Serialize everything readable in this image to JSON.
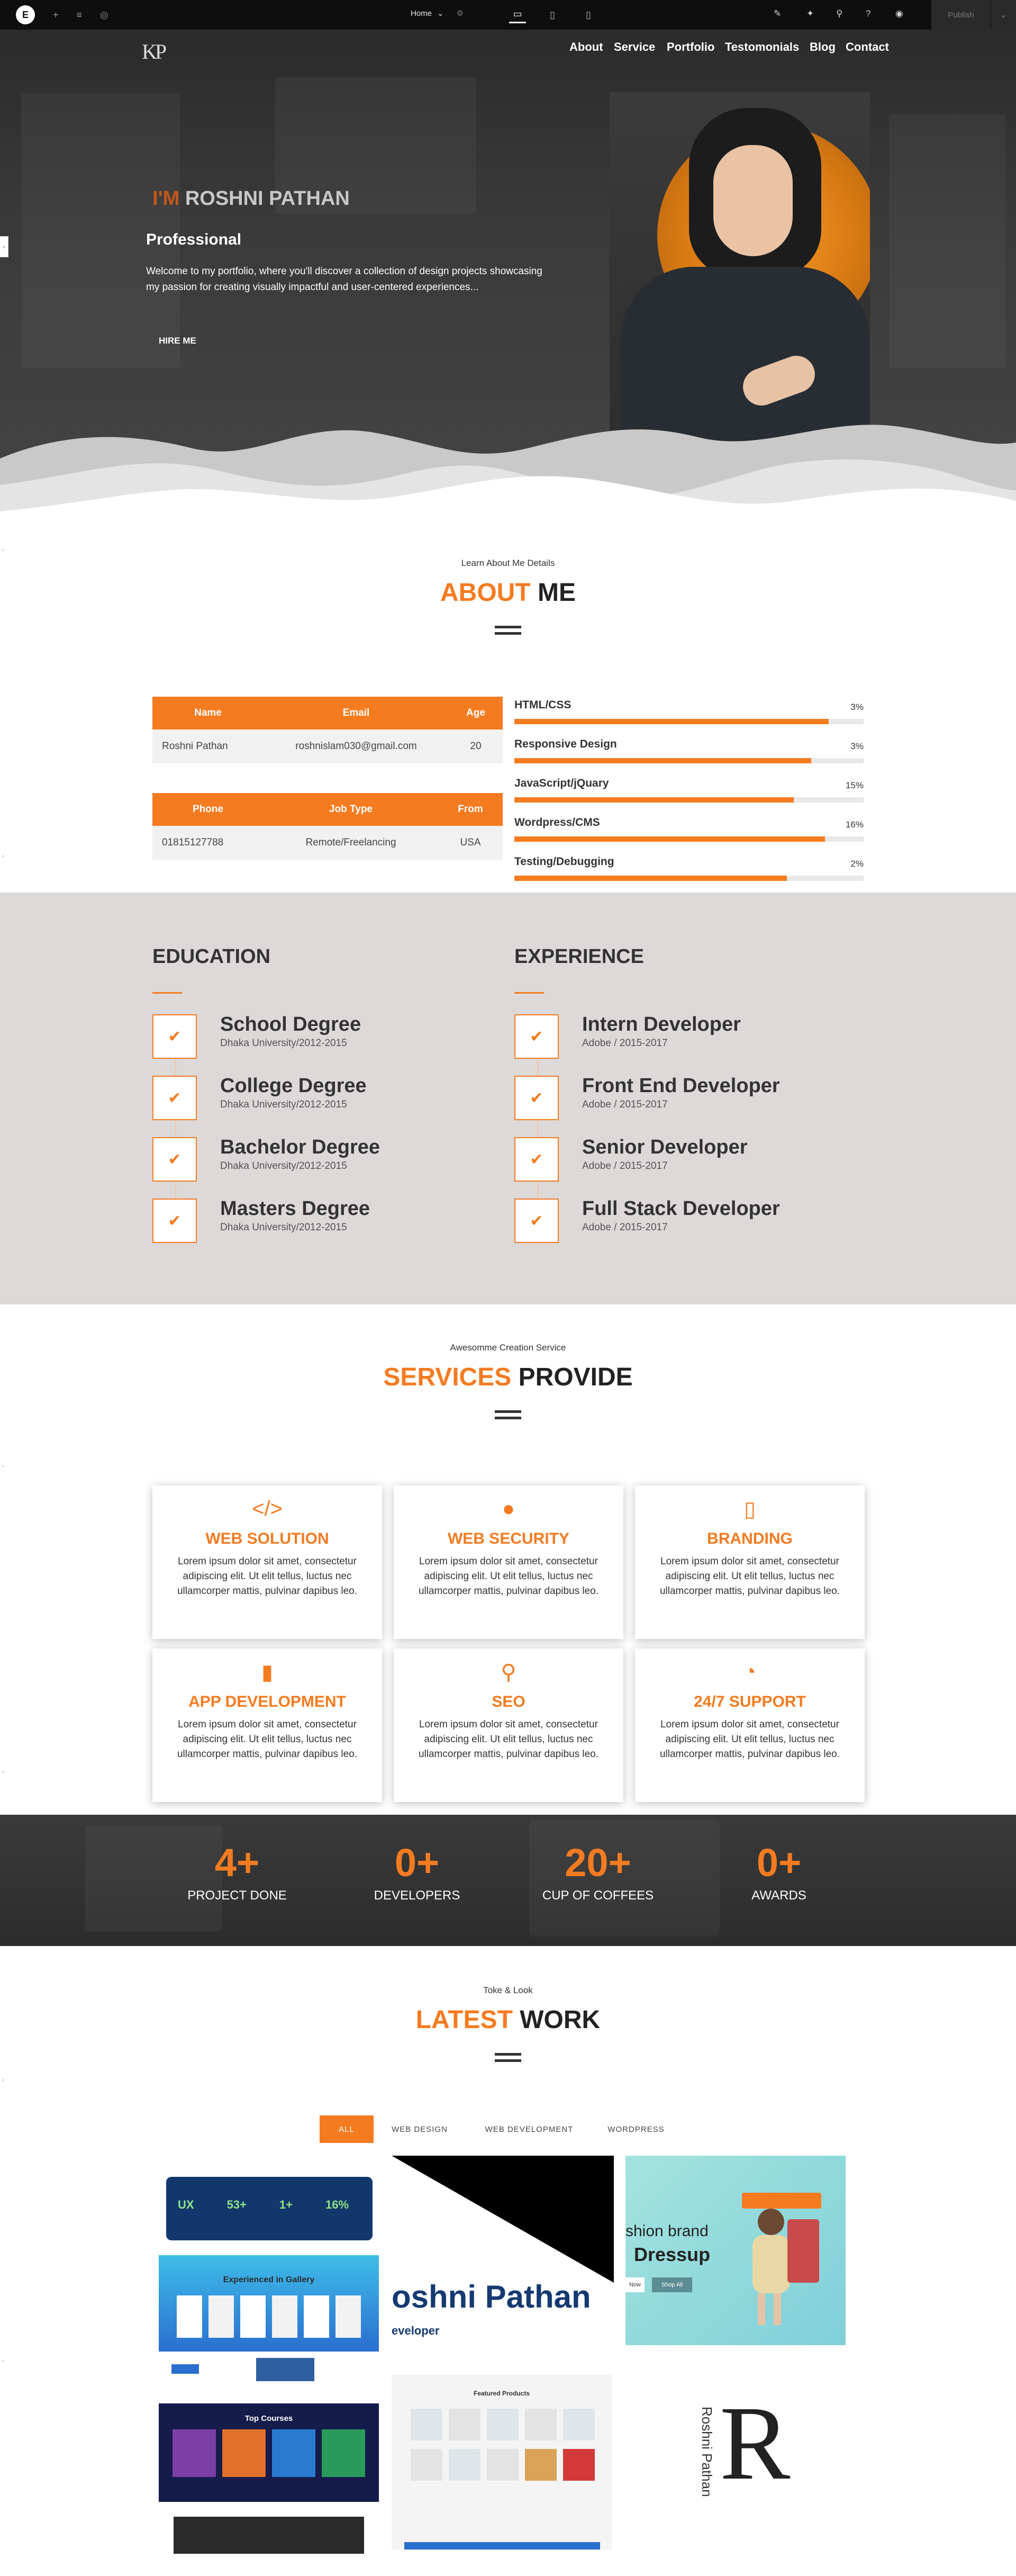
{
  "editor": {
    "logo": "E",
    "page_label": "Home",
    "publish_label": "Publish"
  },
  "nav": {
    "logo": "KP",
    "items": [
      "About",
      "Service",
      "Portfolio",
      "Testomonials",
      "Blog",
      "Contact"
    ]
  },
  "hero": {
    "im": "I'M",
    "name": "ROSHNI PATHAN",
    "subtitle": "Professional",
    "description": "Welcome to my portfolio, where you'll discover a collection of design projects showcasing my passion for creating visually impactful and user-centered experiences...",
    "button": "HIRE ME"
  },
  "about": {
    "pre": "Learn About Me Details",
    "title_accent": "ABOUT",
    "title_rest": " ME",
    "table1": {
      "headers": [
        "Name",
        "Email",
        "Age"
      ],
      "row": [
        "Roshni Pathan",
        "roshnislam030@gmail.com",
        "20"
      ]
    },
    "table2": {
      "headers": [
        "Phone",
        "Job Type",
        "From"
      ],
      "row": [
        "01815127788",
        "Remote/Freelancing",
        "USA"
      ]
    },
    "skills": [
      {
        "label": "HTML/CSS",
        "pct": "3%",
        "fill": 0.9
      },
      {
        "label": "Responsive Design",
        "pct": "3%",
        "fill": 0.85
      },
      {
        "label": "JavaScript/jQuary",
        "pct": "15%",
        "fill": 0.8
      },
      {
        "label": "Wordpress/CMS",
        "pct": "16%",
        "fill": 0.89
      },
      {
        "label": "Testing/Debugging",
        "pct": "2%",
        "fill": 0.78
      }
    ]
  },
  "education": {
    "title": "EDUCATION",
    "items": [
      {
        "title": "School Degree",
        "sub": "Dhaka University/2012-2015"
      },
      {
        "title": "College Degree",
        "sub": "Dhaka University/2012-2015"
      },
      {
        "title": "Bachelor Degree",
        "sub": "Dhaka University/2012-2015"
      },
      {
        "title": "Masters Degree",
        "sub": "Dhaka University/2012-2015"
      }
    ]
  },
  "experience": {
    "title": "EXPERIENCE",
    "items": [
      {
        "title": "Intern Developer",
        "sub": "Adobe / 2015-2017"
      },
      {
        "title": "Front End Developer",
        "sub": "Adobe / 2015-2017"
      },
      {
        "title": "Senior Developer",
        "sub": "Adobe / 2015-2017"
      },
      {
        "title": "Full Stack Developer",
        "sub": "Adobe / 2015-2017"
      }
    ]
  },
  "services": {
    "pre": "Awesomme Creation  Service",
    "title_accent": "SERVICES",
    "title_rest": " PROVIDE",
    "cards": [
      {
        "icon": "code-icon",
        "glyph": "</>",
        "title": "WEB SOLUTION",
        "text": "Lorem ipsum dolor sit amet, consectetur adipiscing elit. Ut elit tellus, luctus nec ullamcorper mattis, pulvinar dapibus leo."
      },
      {
        "icon": "globe-icon",
        "glyph": "●",
        "title": "WEB SECURITY",
        "text": "Lorem ipsum dolor sit amet, consectetur adipiscing elit. Ut elit tellus, luctus nec ullamcorper mattis, pulvinar dapibus leo."
      },
      {
        "icon": "file-icon",
        "glyph": "▯",
        "title": "BRANDING",
        "text": "Lorem ipsum dolor sit amet, consectetur adipiscing elit. Ut elit tellus, luctus nec ullamcorper mattis, pulvinar dapibus leo."
      },
      {
        "icon": "mobile-icon",
        "glyph": "▮",
        "title": "APP DEVELOPMENT",
        "text": "Lorem ipsum dolor sit amet, consectetur adipiscing elit. Ut elit tellus, luctus nec ullamcorper mattis, pulvinar dapibus leo."
      },
      {
        "icon": "search-icon",
        "glyph": "⚲",
        "title": "SEO",
        "text": "Lorem ipsum dolor sit amet, consectetur adipiscing elit. Ut elit tellus, luctus nec ullamcorper mattis, pulvinar dapibus leo."
      },
      {
        "icon": "clock-icon",
        "glyph": "◔",
        "title": "24/7 SUPPORT",
        "text": "Lorem ipsum dolor sit amet, consectetur adipiscing elit. Ut elit tellus, luctus nec ullamcorper mattis, pulvinar dapibus leo."
      }
    ]
  },
  "counters": [
    {
      "num": "4+",
      "label": "PROJECT DONE"
    },
    {
      "num": "0+",
      "label": "DEVELOPERS"
    },
    {
      "num": "20+",
      "label": "CUP OF COFFEES"
    },
    {
      "num": "0+",
      "label": "AWARDS"
    }
  ],
  "work": {
    "pre": "Toke & Look",
    "title_accent": "LATEST",
    "title_rest": " WORK",
    "filters": [
      "ALL",
      "WEB DESIGN",
      "WEB DEVELOPMENT",
      "WORDPRESS"
    ],
    "thumbs": {
      "stats": [
        "UX",
        "53+",
        "1+",
        "16%"
      ],
      "gallery_caption": "Experienced in Gallery",
      "courses_caption": "Top Courses",
      "brand_name": "oshni Pathan",
      "brand_sub": "eveloper",
      "fashion_line1": "shion brand",
      "fashion_line2": "Dressup",
      "fashion_btn": "Shop All",
      "fashion_btn2": "Now",
      "products_caption": "Featured Products",
      "signature": "Roshni Pathan",
      "signature_letter": "R"
    }
  },
  "colors": {
    "accent": "#f47b20",
    "dark": "#2b2b2b",
    "section_gray": "#dcd9d8"
  }
}
